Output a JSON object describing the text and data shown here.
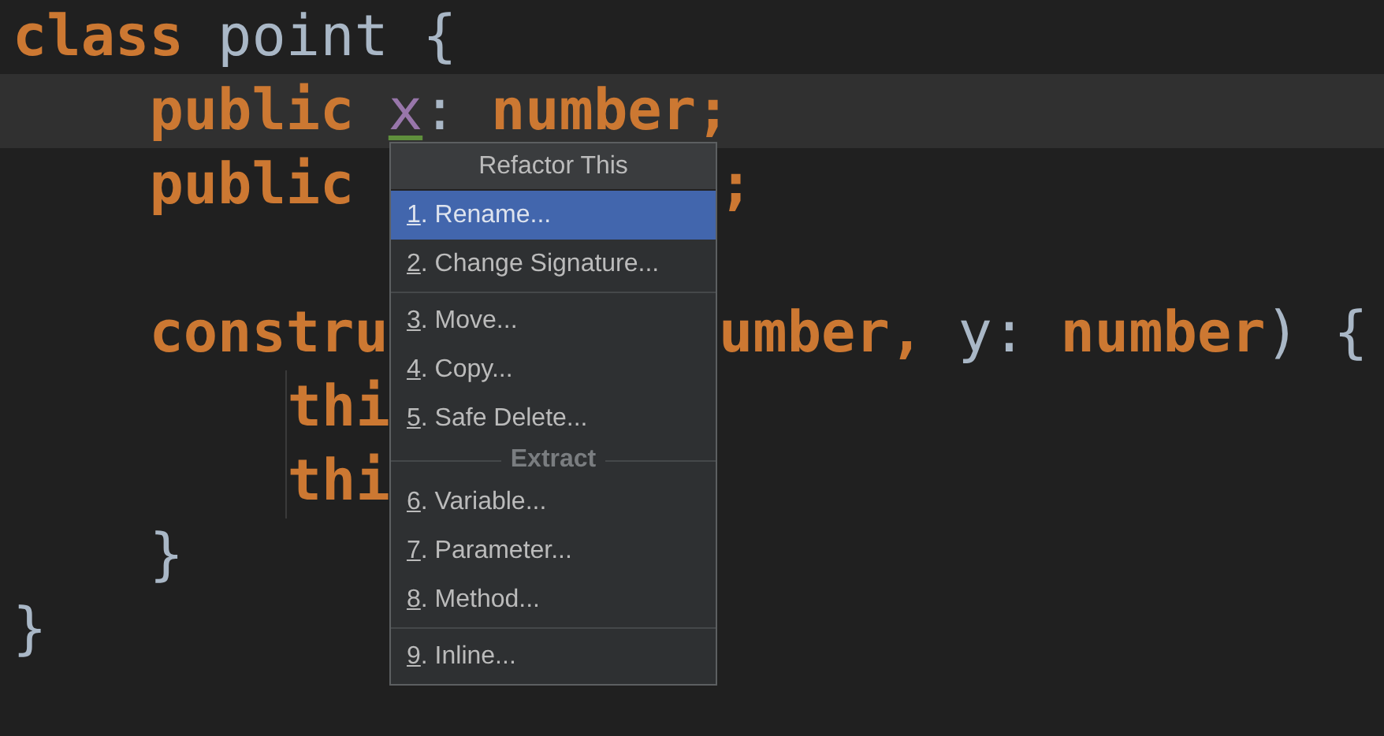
{
  "code": [
    {
      "kind": "code",
      "current": false,
      "tokens": [
        {
          "kind": "keyword",
          "text": "class"
        },
        {
          "kind": "plain",
          "text": " point {"
        }
      ],
      "children": [
        {
          "kind": "code",
          "current": true,
          "tokens": [
            {
              "kind": "keyword",
              "text": "public "
            },
            {
              "kind": "field",
              "text": "x"
            },
            {
              "kind": "plain",
              "text": ": "
            },
            {
              "kind": "keyword",
              "text": "number;"
            }
          ]
        },
        {
          "kind": "code",
          "current": false,
          "tokens": [
            {
              "kind": "keyword",
              "text": "public"
            }
          ],
          "right": [
            {
              "kind": "keyword",
              "text": ";"
            }
          ]
        },
        {
          "kind": "blank"
        },
        {
          "kind": "code",
          "current": false,
          "tokens": [
            {
              "kind": "keyword",
              "text": "constru"
            }
          ],
          "right": [
            {
              "kind": "keyword",
              "text": "umber, "
            },
            {
              "kind": "plain",
              "text": "y: "
            },
            {
              "kind": "keyword",
              "text": "number"
            },
            {
              "kind": "plain",
              "text": ") {"
            }
          ],
          "children": [
            {
              "kind": "code",
              "current": false,
              "tokens": [
                {
                  "kind": "keyword",
                  "text": "thi"
                }
              ]
            },
            {
              "kind": "code",
              "current": false,
              "tokens": [
                {
                  "kind": "keyword",
                  "text": "thi"
                }
              ]
            }
          ]
        },
        {
          "kind": "code",
          "current": false,
          "tokens": [
            {
              "kind": "plain",
              "text": "}"
            }
          ]
        }
      ]
    },
    {
      "kind": "code",
      "current": false,
      "tokens": [
        {
          "kind": "plain",
          "text": "}"
        }
      ]
    }
  ],
  "menu": {
    "title": "Refactor This",
    "groups": [
      {
        "items": [
          {
            "mnemonic": "1",
            "label": ". Rename...",
            "selected": true
          },
          {
            "mnemonic": "2",
            "label": ". Change Signature...",
            "selected": false
          }
        ]
      },
      {
        "items": [
          {
            "mnemonic": "3",
            "label": ". Move...",
            "selected": false
          },
          {
            "mnemonic": "4",
            "label": ". Copy...",
            "selected": false
          },
          {
            "mnemonic": "5",
            "label": ". Safe Delete...",
            "selected": false
          }
        ]
      },
      {
        "heading": "Extract",
        "items": [
          {
            "mnemonic": "6",
            "label": ". Variable...",
            "selected": false
          },
          {
            "mnemonic": "7",
            "label": ". Parameter...",
            "selected": false
          },
          {
            "mnemonic": "8",
            "label": ". Method...",
            "selected": false
          }
        ]
      },
      {
        "items": [
          {
            "mnemonic": "9",
            "label": ". Inline...",
            "selected": false
          }
        ]
      }
    ]
  }
}
